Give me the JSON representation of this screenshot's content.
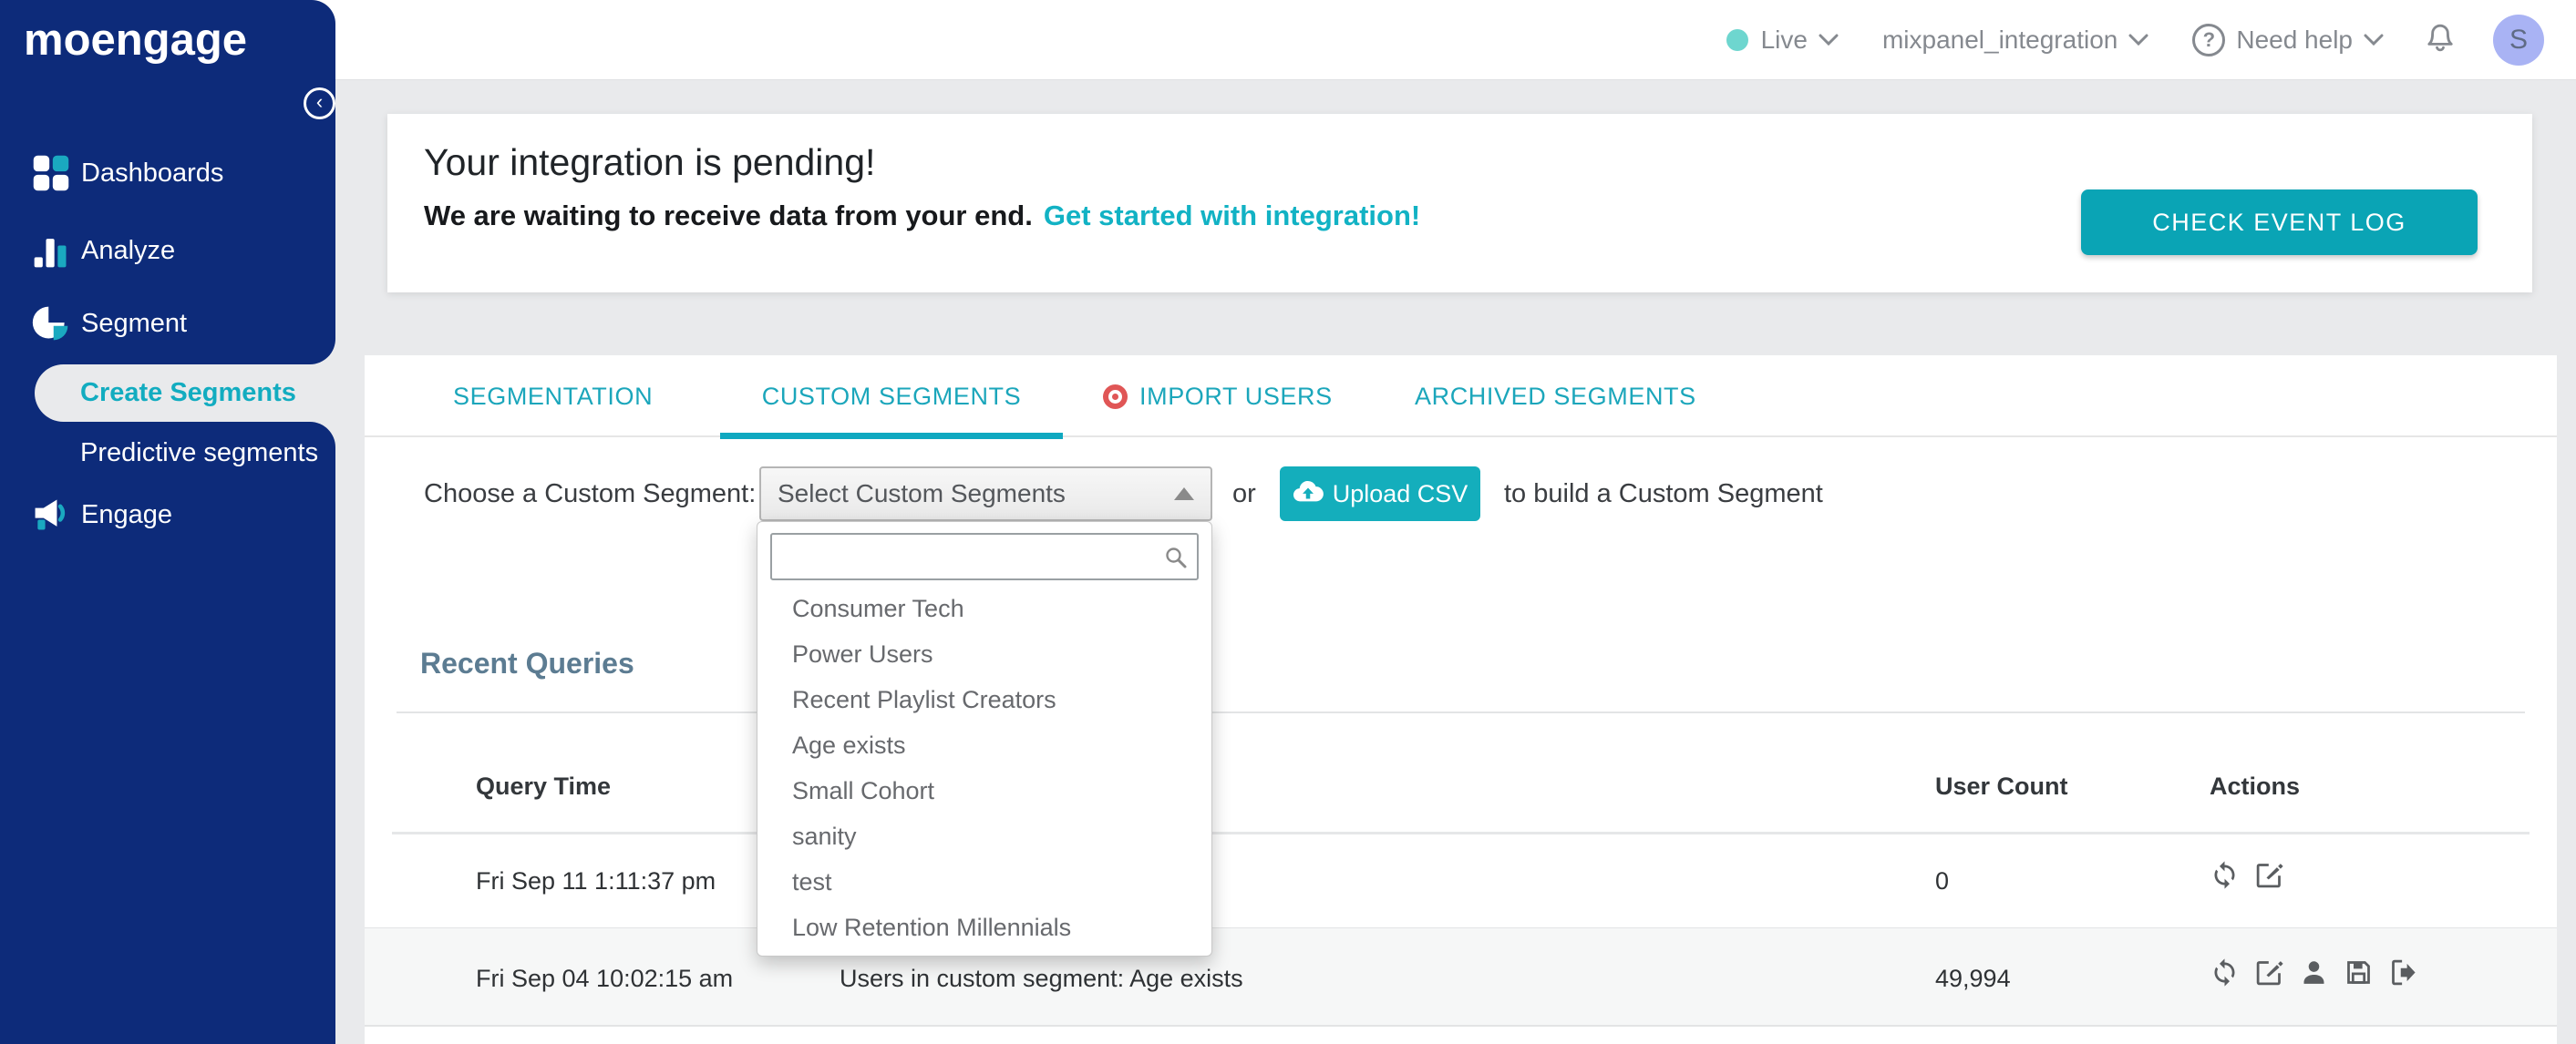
{
  "sidebar": {
    "logo_text": "moengage",
    "items": [
      {
        "label": "Dashboards",
        "icon": "grid-icon"
      },
      {
        "label": "Analyze",
        "icon": "bar-chart-icon"
      },
      {
        "label": "Segment",
        "icon": "pie-chart-icon"
      },
      {
        "label": "Create Segments",
        "active": true
      },
      {
        "label": "Predictive segments"
      },
      {
        "label": "Engage",
        "icon": "megaphone-icon"
      }
    ]
  },
  "topbar": {
    "environment": {
      "label": "Live",
      "status_dot_color": "#6ed6cf"
    },
    "workspace": "mixpanel_integration",
    "help_label": "Need help",
    "avatar_initial": "S"
  },
  "banner": {
    "title": "Your integration is pending!",
    "message": "We are waiting to receive data from your end.",
    "link_label": "Get started with integration!",
    "button_label": "CHECK EVENT LOG"
  },
  "tabs": [
    {
      "label": "SEGMENTATION",
      "active": false
    },
    {
      "label": "CUSTOM SEGMENTS",
      "active": true
    },
    {
      "label": "IMPORT USERS",
      "active": false,
      "badge": "red-target-dot"
    },
    {
      "label": "ARCHIVED SEGMENTS",
      "active": false
    }
  ],
  "segment_picker": {
    "label": "Choose a Custom Segment:",
    "select_value": "Select Custom Segments",
    "or_text": "or",
    "upload_button_label": "Upload CSV",
    "suffix_text": "to build a Custom Segment",
    "search_value": "",
    "options": [
      "Consumer Tech",
      "Power Users",
      "Recent Playlist Creators",
      "Age exists",
      "Small Cohort",
      "sanity",
      "test",
      "Low Retention Millennials"
    ]
  },
  "recent_queries": {
    "title": "Recent Queries",
    "columns": {
      "time": "Query Time",
      "count": "User Count",
      "actions": "Actions"
    },
    "rows": [
      {
        "query_time": "Fri Sep 11 1:11:37 pm",
        "description": "",
        "user_count": "0",
        "actions": [
          "refresh",
          "edit"
        ]
      },
      {
        "query_time": "Fri Sep 04 10:02:15 am",
        "description": "Users in custom segment: Age exists",
        "user_count": "49,994",
        "actions": [
          "refresh",
          "edit",
          "user",
          "save",
          "export"
        ]
      }
    ]
  },
  "colors": {
    "sidebar_navy": "#0d2b7a",
    "accent_teal": "#0aa4b5",
    "upload_teal": "#14aebc",
    "link_teal": "#12b2c4",
    "active_nav_teal": "#12acc0",
    "heading_slate": "#5c7c92",
    "import_badge_red": "#e05656",
    "avatar_bg": "#a9b3f4",
    "page_bg": "#e9eaec",
    "alt_row_bg": "#f6f7f7"
  }
}
